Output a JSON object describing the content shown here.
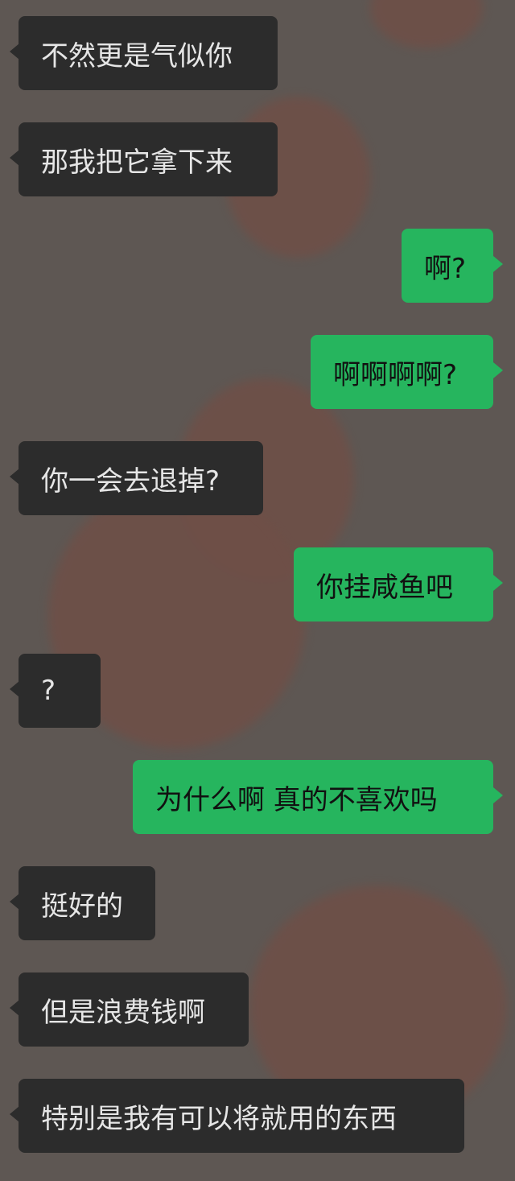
{
  "colors": {
    "background": "#5e5753",
    "incoming_bubble": "#2c2c2c",
    "incoming_text": "#e6e6e6",
    "outgoing_bubble": "#26b55e",
    "outgoing_text": "#111111"
  },
  "messages": [
    {
      "direction": "incoming",
      "text": "不然更是气似你"
    },
    {
      "direction": "incoming",
      "text": "那我把它拿下来"
    },
    {
      "direction": "outgoing",
      "text": "啊?"
    },
    {
      "direction": "outgoing",
      "text": "啊啊啊啊?"
    },
    {
      "direction": "incoming",
      "text": "你一会去退掉?"
    },
    {
      "direction": "outgoing",
      "text": "你挂咸鱼吧"
    },
    {
      "direction": "incoming",
      "text": "?"
    },
    {
      "direction": "outgoing",
      "text": "为什么啊 真的不喜欢吗"
    },
    {
      "direction": "incoming",
      "text": "挺好的"
    },
    {
      "direction": "incoming",
      "text": "但是浪费钱啊"
    },
    {
      "direction": "incoming",
      "text": "特别是我有可以将就用的东西"
    }
  ]
}
